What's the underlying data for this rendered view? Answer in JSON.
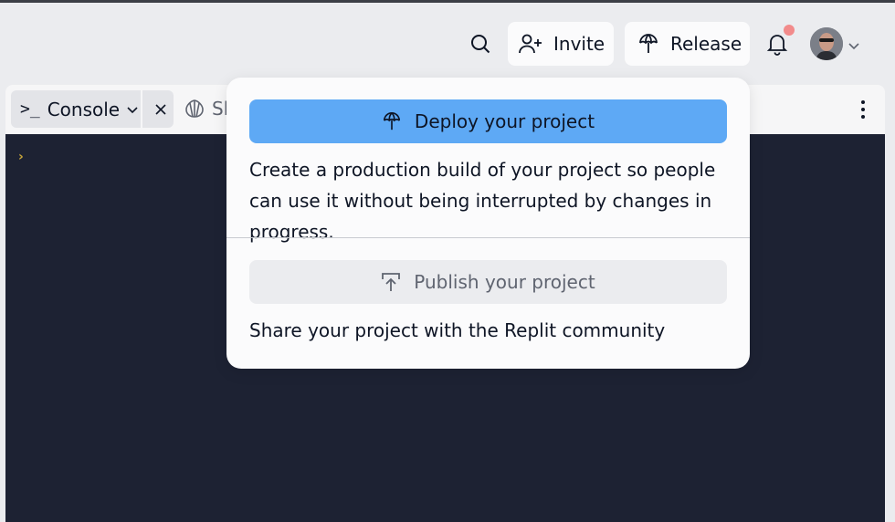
{
  "header": {
    "invite_label": "Invite",
    "release_label": "Release",
    "notification_dot_color": "#f28b8b",
    "icons": [
      "search-icon",
      "add-user-icon",
      "release-icon",
      "bell-icon",
      "chevron-down-icon"
    ]
  },
  "tabs": {
    "console_prompt": ">_",
    "console_label": "Console",
    "second_label": "Sh"
  },
  "console": {
    "prompt_glyph": "›"
  },
  "popover": {
    "deploy_label": "Deploy your project",
    "deploy_description": "Create a production build of your project so people can use it without being interrupted by changes in progress.",
    "publish_label": "Publish your project",
    "publish_description": "Share your project with the Replit community",
    "accent_color": "#5ea9f5"
  }
}
